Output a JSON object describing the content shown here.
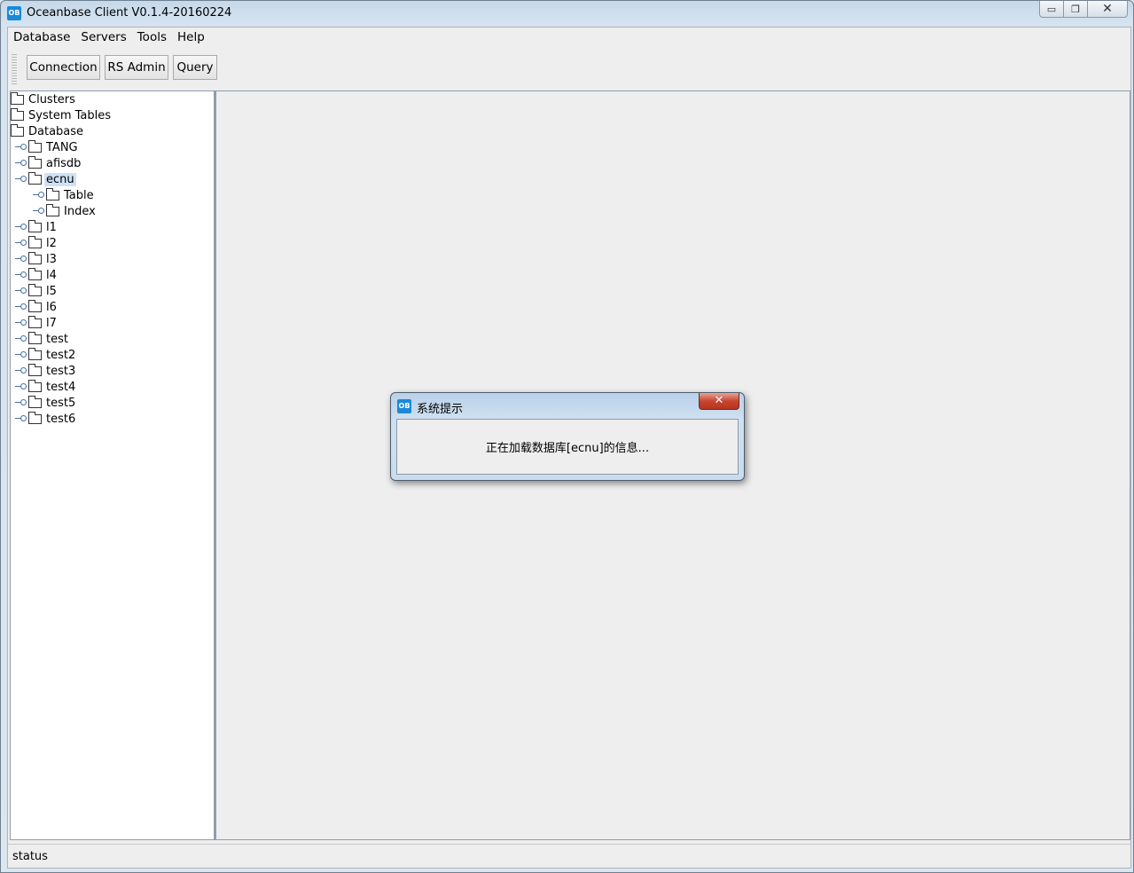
{
  "window": {
    "title": "Oceanbase Client V0.1.4-20160224",
    "icon_text": "OB"
  },
  "menu": [
    "Database",
    "Servers",
    "Tools",
    "Help"
  ],
  "toolbar": {
    "connection_label": "Connection",
    "rs_admin_label": "RS Admin",
    "query_label": "Query"
  },
  "tree": {
    "clusters": "Clusters",
    "system_tables": "System Tables",
    "database": "Database",
    "databases": [
      "TANG",
      "afisdb",
      "ecnu",
      "l1",
      "l2",
      "l3",
      "l4",
      "l5",
      "l6",
      "l7",
      "test",
      "test2",
      "test3",
      "test4",
      "test5",
      "test6"
    ],
    "selected": "ecnu",
    "ecnu_children": [
      "Table",
      "Index"
    ]
  },
  "status": {
    "text": "status"
  },
  "dialog": {
    "title": "系统提示",
    "message": "正在加载数据库[ecnu]的信息...",
    "close_symbol": "✕"
  },
  "colors": {
    "selection": "#cfe2f5",
    "accent": "#1a8ad8",
    "close_button": "#c8452f"
  }
}
